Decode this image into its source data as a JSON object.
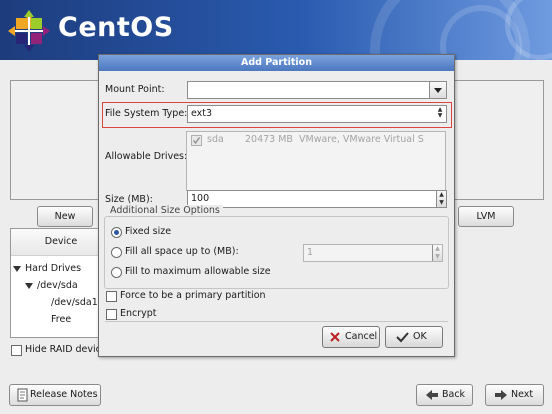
{
  "header": {
    "brand": "CentOS"
  },
  "background": {
    "new_button_label": "New",
    "lvm_button_label": "LVM",
    "tree": {
      "column_header": "Device",
      "rows": [
        "Hard Drives",
        "/dev/sda",
        "/dev/sda1",
        "Free"
      ]
    },
    "hide_raid_label": "Hide RAID devic",
    "release_notes_label": "Release Notes",
    "back_label": "Back",
    "next_label": "Next"
  },
  "dialog": {
    "title": "Add Partition",
    "mount_point_label": "Mount Point:",
    "mount_point_value": "",
    "fs_type_label": "File System Type:",
    "fs_type_value": "ext3",
    "allowable_drives_label": "Allowable Drives:",
    "drive": {
      "name": "sda",
      "size": "20473 MB",
      "model": "VMware, VMware Virtual S",
      "checked": true
    },
    "size_label": "Size (MB):",
    "size_value": "100",
    "options_title": "Additional Size Options",
    "option_fixed": "Fixed size",
    "option_fill_up_to": "Fill all space up to (MB):",
    "fill_up_to_value": "1",
    "option_fill_max": "Fill to maximum allowable size",
    "primary_label": "Force to be a primary partition",
    "encrypt_label": "Encrypt",
    "cancel_label": "Cancel",
    "ok_label": "OK"
  },
  "colors": {
    "banner": "#2a5bb0",
    "titlebar": "#4d78bf",
    "highlight": "#d9453f"
  }
}
